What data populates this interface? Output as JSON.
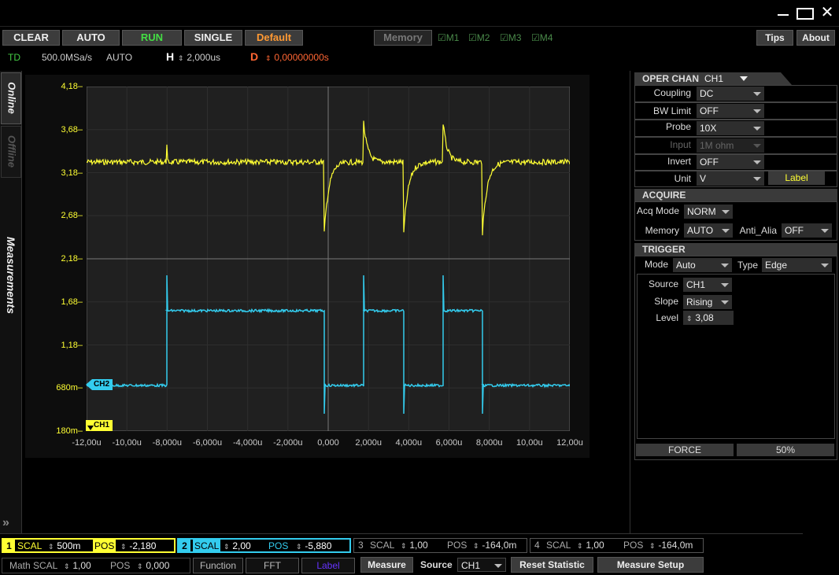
{
  "window": {
    "minimize_glyph": "—",
    "maximize_glyph": "☐",
    "close_glyph": "✕"
  },
  "toolbar": {
    "clear": "CLEAR",
    "auto": "AUTO",
    "run": "RUN",
    "single": "SINGLE",
    "default": "Default",
    "memory": "Memory",
    "m1": "M1",
    "m2": "M2",
    "m3": "M3",
    "m4": "M4",
    "tips": "Tips",
    "about": "About"
  },
  "status": {
    "td": "TD",
    "sample_rate": "500.0MSa/s",
    "mode": "AUTO",
    "h_label": "H",
    "h_value": "2,000us",
    "d_label": "D",
    "d_value": "0,00000000s"
  },
  "side_tabs": {
    "online": "Online",
    "offline": "Offline",
    "measurements": "Measurements",
    "expand": "»"
  },
  "graph": {
    "y_ticks": [
      "4,18",
      "3,68",
      "3,18",
      "2,68",
      "2,18",
      "1,68",
      "1,18",
      "680m",
      "180m"
    ],
    "x_ticks": [
      "-12,00u",
      "-10,00u",
      "-8,000u",
      "-6,000u",
      "-4,000u",
      "-2,000u",
      "0,000",
      "2,000u",
      "4,000u",
      "6,000u",
      "8,000u",
      "10,00u",
      "12,00u"
    ],
    "ch2_marker": "CH2",
    "ch1_marker": "CH1",
    "ch1_color": "#ffff33",
    "ch2_color": "#33ccee"
  },
  "oper": {
    "title": "OPER CHAN",
    "channel": "CH1",
    "coupling_label": "Coupling",
    "coupling": "DC",
    "bw_label": "BW Limit",
    "bw": "OFF",
    "probe_label": "Probe",
    "probe": "10X",
    "input_label": "Input",
    "input": "1M ohm",
    "invert_label": "Invert",
    "invert": "OFF",
    "unit_label": "Unit",
    "unit": "V",
    "label_btn": "Label"
  },
  "acquire": {
    "title": "ACQUIRE",
    "acq_mode_label": "Acq Mode",
    "acq_mode": "NORM",
    "memory_label": "Memory",
    "memory": "AUTO",
    "anti_label": "Anti_Alia",
    "anti": "OFF"
  },
  "trigger": {
    "title": "TRIGGER",
    "mode_label": "Mode",
    "mode": "Auto",
    "type_label": "Type",
    "type": "Edge",
    "source_label": "Source",
    "source": "CH1",
    "slope_label": "Slope",
    "slope": "Rising",
    "level_label": "Level",
    "level": "3,08",
    "force": "FORCE",
    "percent": "50%"
  },
  "bottom": {
    "ch1": {
      "num": "1",
      "scal_label": "SCAL",
      "scal": "500m",
      "pos_label": "POS",
      "pos": "-2,180"
    },
    "ch2": {
      "num": "2",
      "scal_label": "SCAL",
      "scal": "2,00",
      "pos_label": "POS",
      "pos": "-5,880"
    },
    "ch3": {
      "num": "3",
      "scal_label": "SCAL",
      "scal": "1,00",
      "pos_label": "POS",
      "pos": "-164,0m"
    },
    "ch4": {
      "num": "4",
      "scal_label": "SCAL",
      "scal": "1,00",
      "pos_label": "POS",
      "pos": "-164,0m"
    },
    "math": {
      "label": "Math",
      "scal_label": "SCAL",
      "scal": "1,00",
      "pos_label": "POS",
      "pos": "0,000",
      "function": "Function",
      "fft": "FFT",
      "label_btn": "Label"
    },
    "measure": "Measure",
    "source_label": "Source",
    "source": "CH1",
    "reset": "Reset",
    "statistic": "Statistic",
    "measure_setup": "Measure Setup"
  }
}
